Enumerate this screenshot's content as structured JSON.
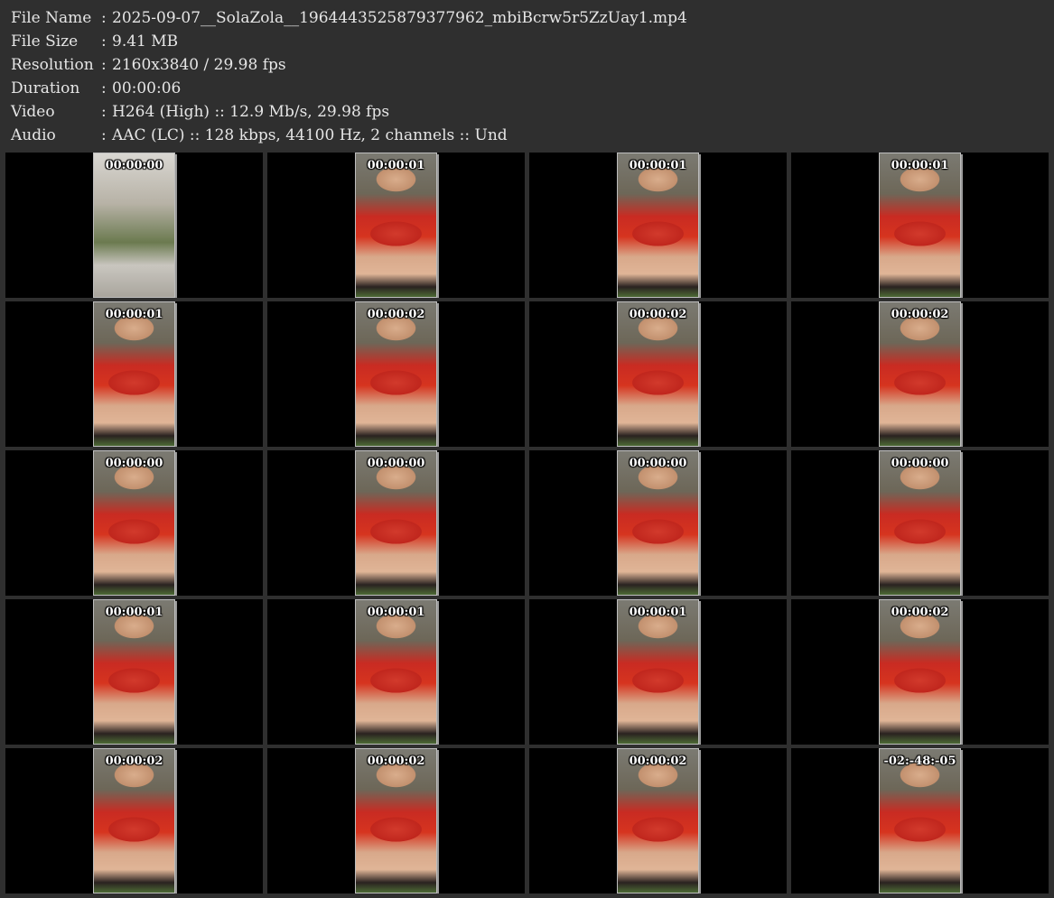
{
  "info": [
    {
      "label": "File Name",
      "value": "2025-09-07__SolaZola__1964443525879377962_mbiBcrw5r5ZzUay1.mp4"
    },
    {
      "label": "File Size",
      "value": "9.41 MB"
    },
    {
      "label": "Resolution",
      "value": "2160x3840 / 29.98 fps"
    },
    {
      "label": "Duration",
      "value": "00:00:06"
    },
    {
      "label": "Video",
      "value": "H264 (High) :: 12.9 Mb/s, 29.98 fps"
    },
    {
      "label": "Audio",
      "value": "AAC (LC) :: 128 kbps, 44100 Hz, 2 channels :: Und"
    }
  ],
  "separator": ":",
  "thumbnails": [
    "00:00:00",
    "00:00:01",
    "00:00:01",
    "00:00:01",
    "00:00:01",
    "00:00:02",
    "00:00:02",
    "00:00:02",
    "00:00:00",
    "00:00:00",
    "00:00:00",
    "00:00:00",
    "00:00:01",
    "00:00:01",
    "00:00:01",
    "00:00:02",
    "00:00:02",
    "00:00:02",
    "00:00:02",
    "-02:-48:-05"
  ],
  "colors": {
    "background": "#2f2f2f",
    "cell": "#000000",
    "text": "#e6e6e6"
  }
}
